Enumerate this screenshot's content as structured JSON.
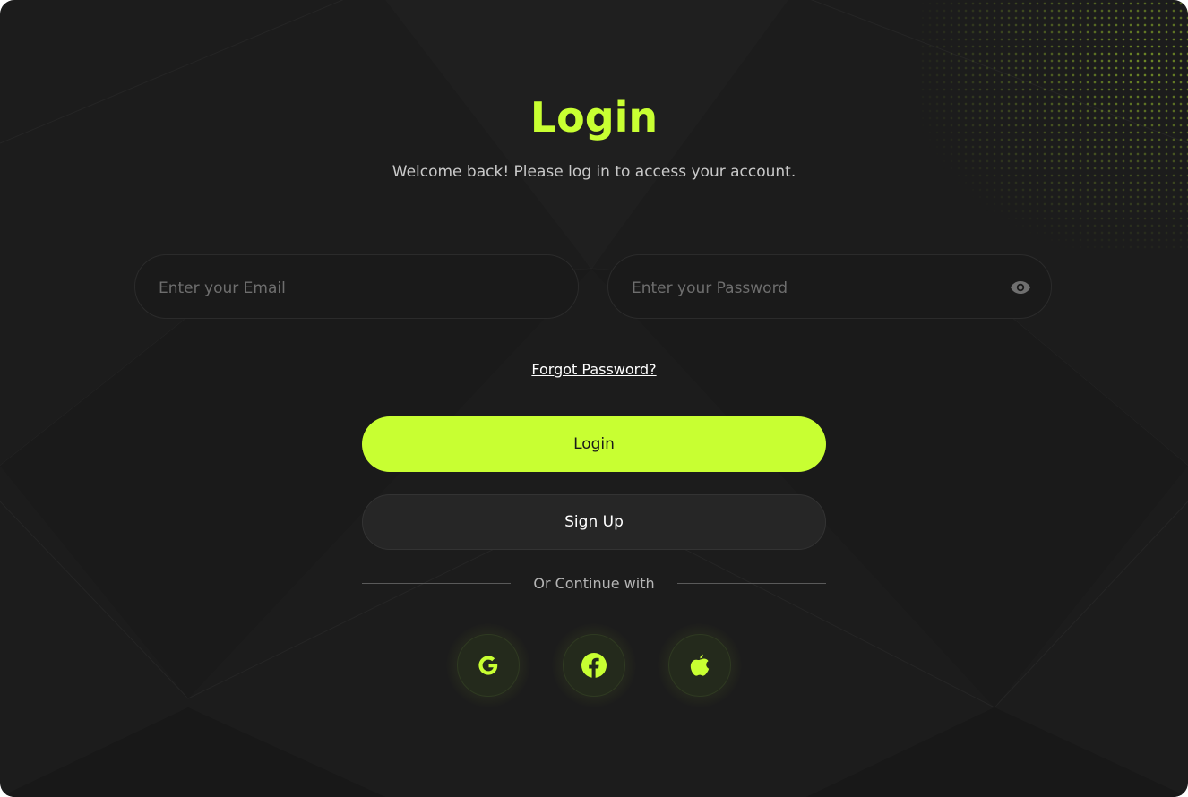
{
  "page": {
    "title": "Login",
    "subtitle": "Welcome back! Please log in to access your account."
  },
  "form": {
    "email": {
      "placeholder": "Enter your Email",
      "value": ""
    },
    "password": {
      "placeholder": "Enter your Password",
      "value": "",
      "toggle_icon": "eye-icon"
    },
    "forgot_label": "Forgot Password?",
    "login_label": "Login",
    "signup_label": "Sign Up"
  },
  "social": {
    "divider_label": "Or Continue with",
    "providers": [
      {
        "name": "Google",
        "icon": "google-icon"
      },
      {
        "name": "Facebook",
        "icon": "facebook-icon"
      },
      {
        "name": "Apple",
        "icon": "apple-icon"
      }
    ]
  },
  "theme": {
    "accent": "#c8ff32",
    "background": "#1c1c1c",
    "input_background": "#1a1a1a",
    "secondary_button": "#262626"
  }
}
